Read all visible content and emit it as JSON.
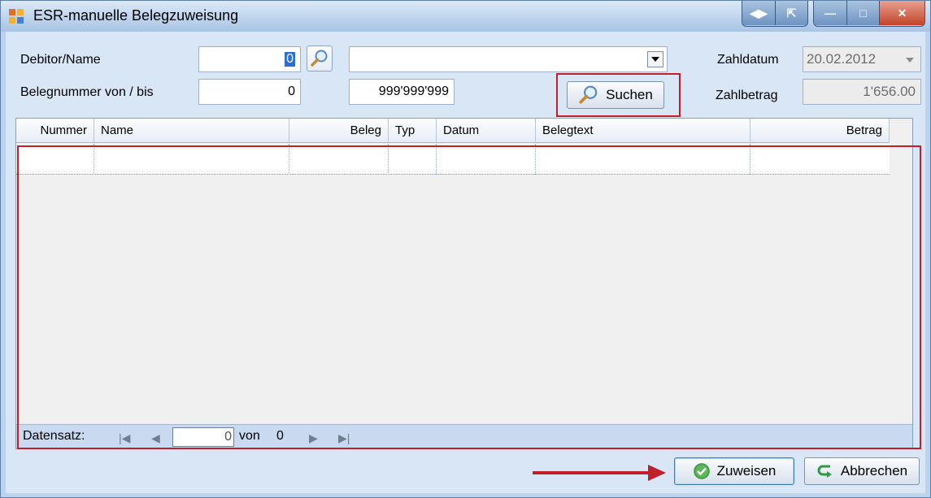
{
  "window": {
    "title": "ESR-manuelle Belegzuweisung"
  },
  "form": {
    "debitor_label": "Debitor/Name",
    "debitor_value": "0",
    "name_combo_value": "",
    "beleg_label": "Belegnummer von / bis",
    "beleg_from": "0",
    "beleg_to": "999'999'999",
    "search_button": "Suchen",
    "zahldatum_label": "Zahldatum",
    "zahldatum_value": "20.02.2012",
    "zahlbetrag_label": "Zahlbetrag",
    "zahlbetrag_value": "1'656.00"
  },
  "grid": {
    "columns": [
      "Nummer",
      "Name",
      "Beleg",
      "Typ",
      "Datum",
      "Belegtext",
      "Betrag"
    ],
    "rows": []
  },
  "navigator": {
    "label": "Datensatz:",
    "position": "0",
    "of_label": "von",
    "total": "0"
  },
  "actions": {
    "assign": "Zuweisen",
    "cancel": "Abbrechen"
  },
  "colors": {
    "highlight": "#c0202a",
    "accent": "#2b6fd1"
  },
  "icons": {
    "app": "app-grid-icon",
    "search": "magnifier-icon",
    "assign": "check-circle-icon",
    "cancel": "undo-arrow-icon"
  }
}
